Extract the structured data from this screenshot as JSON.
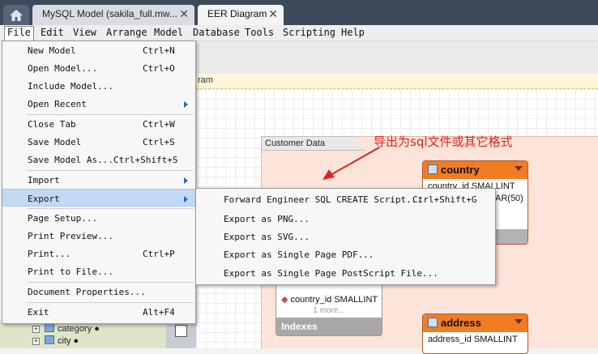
{
  "tabs": [
    {
      "label": "MySQL Model (sakila_full.mw..."
    },
    {
      "label": "EER Diagram"
    }
  ],
  "menubar": [
    "File",
    "Edit",
    "View",
    "Arrange",
    "Model",
    "Database",
    "Tools",
    "Scripting",
    "Help"
  ],
  "notice_text": "ram",
  "layer": {
    "label": "Customer Data"
  },
  "annotation": "导出为sql文件或其它格式",
  "entities": {
    "country": {
      "title": "country",
      "column": "country_id SMALLINT",
      "column2_fragment": "AR(50)"
    },
    "city": {
      "column": "country_id SMALLINT",
      "more": "1 more...",
      "indexes": "Indexes"
    },
    "address": {
      "title": "address",
      "column": "address_id SMALLINT"
    }
  },
  "tree": [
    {
      "label": "category ●"
    },
    {
      "label": "city ●"
    }
  ],
  "file_menu": {
    "items": [
      {
        "label": "New Model",
        "shortcut": "Ctrl+N"
      },
      {
        "label": "Open Model...",
        "shortcut": "Ctrl+O"
      },
      {
        "label": "Include Model...",
        "shortcut": ""
      },
      {
        "label": "Open Recent",
        "shortcut": ""
      },
      {
        "label": "Close Tab",
        "shortcut": "Ctrl+W"
      },
      {
        "label": "Save Model",
        "shortcut": "Ctrl+S"
      },
      {
        "label": "Save Model As...",
        "shortcut": "Ctrl+Shift+S"
      },
      {
        "label": "Import",
        "shortcut": ""
      },
      {
        "label": "Export",
        "shortcut": ""
      },
      {
        "label": "Page Setup...",
        "shortcut": ""
      },
      {
        "label": "Print Preview...",
        "shortcut": ""
      },
      {
        "label": "Print...",
        "shortcut": "Ctrl+P"
      },
      {
        "label": "Print to File...",
        "shortcut": ""
      },
      {
        "label": "Document Properties...",
        "shortcut": ""
      },
      {
        "label": "Exit",
        "shortcut": "Alt+F4"
      }
    ]
  },
  "export_menu": {
    "items": [
      {
        "label": "Forward Engineer SQL CREATE Script...",
        "shortcut": "Ctrl+Shift+G"
      },
      {
        "label": "Export as PNG...",
        "shortcut": ""
      },
      {
        "label": "Export as SVG...",
        "shortcut": ""
      },
      {
        "label": "Export as Single Page PDF...",
        "shortcut": ""
      },
      {
        "label": "Export as Single Page PostScript File...",
        "shortcut": ""
      }
    ]
  },
  "colors": {
    "tabbar": "#3c4a5c",
    "entity_header": "#f27c22",
    "layer_fill": "#fde4da",
    "menu_highlight": "#c3d9f3",
    "annotation": "#e0221f"
  }
}
